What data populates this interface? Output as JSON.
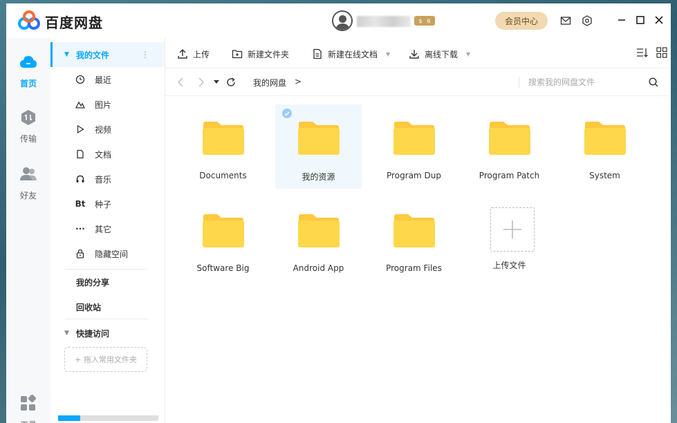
{
  "app": {
    "brand": "百度网盘"
  },
  "header": {
    "vip_level_a": "$",
    "vip_level_b": "6",
    "member_center": "会员中心"
  },
  "rail": [
    {
      "label": "首页",
      "icon": "cloud-icon"
    },
    {
      "label": "传输",
      "icon": "transfer-icon"
    },
    {
      "label": "好友",
      "icon": "friends-icon"
    },
    {
      "label": "工具",
      "icon": "tools-icon"
    }
  ],
  "sidebar": {
    "my_files": "我的文件",
    "items": [
      {
        "label": "最近",
        "icon": "clock-icon"
      },
      {
        "label": "图片",
        "icon": "image-icon"
      },
      {
        "label": "视频",
        "icon": "play-icon"
      },
      {
        "label": "文档",
        "icon": "document-icon"
      },
      {
        "label": "音乐",
        "icon": "headphones-icon"
      },
      {
        "label": "种子",
        "icon": "torrent-icon",
        "glyph": "Bt"
      },
      {
        "label": "其它",
        "icon": "more-icon",
        "glyph": "···"
      },
      {
        "label": "隐藏空间",
        "icon": "lock-icon"
      }
    ],
    "my_share": "我的分享",
    "recycle_bin": "回收站",
    "quick_access": "快捷访问",
    "drop_hint": "+ 拖入常用文件夹",
    "storage_used_fraction": 0.22
  },
  "toolbar": {
    "upload": "上传",
    "new_folder": "新建文件夹",
    "new_online_doc": "新建在线文档",
    "offline_download": "离线下载"
  },
  "nav": {
    "breadcrumb": "我的网盘",
    "separator": ">",
    "search_placeholder": "搜索我的网盘文件"
  },
  "files": [
    {
      "name": "Documents",
      "type": "folder",
      "selected": false
    },
    {
      "name": "我的资源",
      "type": "folder",
      "selected": true
    },
    {
      "name": "Program Dup",
      "type": "folder",
      "selected": false
    },
    {
      "name": "Program Patch",
      "type": "folder",
      "selected": false
    },
    {
      "name": "System",
      "type": "folder",
      "selected": false
    },
    {
      "name": "Software Big",
      "type": "folder",
      "selected": false
    },
    {
      "name": "Android App",
      "type": "folder",
      "selected": false
    },
    {
      "name": "Program Files",
      "type": "folder",
      "selected": false
    },
    {
      "name": "上传文件",
      "type": "upload",
      "selected": false
    }
  ],
  "colors": {
    "accent": "#06a7ff",
    "folder": "#ffd74a",
    "folder_tab": "#ffc83d",
    "member": "#f1d9b1"
  }
}
